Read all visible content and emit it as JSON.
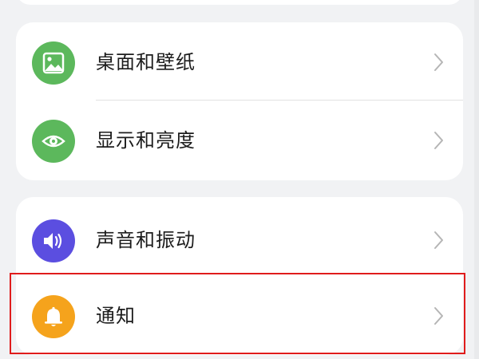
{
  "colors": {
    "background": "#f1f2f4",
    "card": "#ffffff",
    "wallpaper_icon_bg": "#5cb85c",
    "display_icon_bg": "#5cb85c",
    "sound_icon_bg": "#5b4ee0",
    "notification_icon_bg": "#f5a31c",
    "highlight": "#e01c1c"
  },
  "settings": {
    "display_group": [
      {
        "label": "桌面和壁纸",
        "icon": "image-icon"
      },
      {
        "label": "显示和亮度",
        "icon": "eye-icon"
      }
    ],
    "sound_group": [
      {
        "label": "声音和振动",
        "icon": "speaker-icon"
      },
      {
        "label": "通知",
        "icon": "bell-icon"
      }
    ]
  },
  "highlighted_item": "通知"
}
